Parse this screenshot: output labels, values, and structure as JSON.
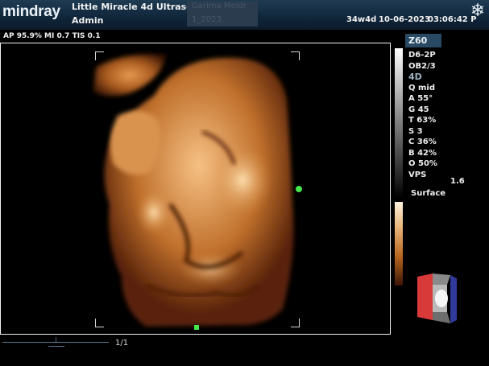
{
  "header": {
    "logo": "mindray",
    "hospital": "Little Miracle 4d Ultrasou...",
    "operator": "Admin",
    "patient_name": "Garima Meldr",
    "patient_id": "1_2023",
    "gestational_age": "34w4d",
    "date": "10-06-2023",
    "time": "03:06:42 P",
    "freeze_icon": "snowflake-icon"
  },
  "acoustic_power": "AP 95.9%  MI 0.7  TIS 0.1",
  "probe": "Z60",
  "params": {
    "transducer": "D6-2P",
    "exam": "OB2/3",
    "mode": "4D",
    "quality": "Q mid",
    "angle": "A 55°",
    "gain": "G 45",
    "threshold": "T 63%",
    "smooth": "S 3",
    "contrast": "C 36%",
    "brightness": "B 42%",
    "opacity": "O 50%",
    "vps_label": "VPS",
    "vps_value": "1.6",
    "render_mode": "Surface"
  },
  "cine": {
    "frame": "1/1"
  },
  "colors": {
    "header_bg": "#132b40",
    "probe_label_bg": "#2a4a63",
    "marker": "#44e84a",
    "sepia": "#c86e28"
  }
}
